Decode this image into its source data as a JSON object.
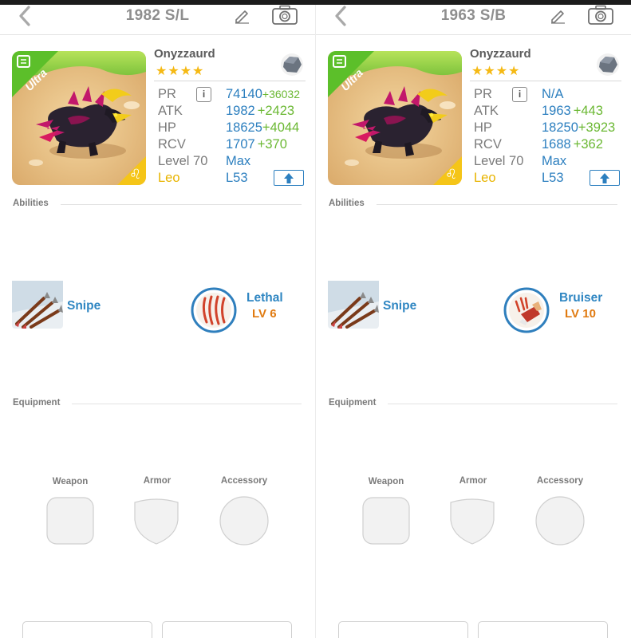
{
  "screens": [
    {
      "title": "1982 S/L",
      "monster": {
        "name": "Onyzzaurd",
        "stars": "★★★★",
        "rarity": "Ultra",
        "element": "stone",
        "zodiac_glyph": "♌"
      },
      "stats": {
        "pr_label": "PR",
        "pr_value": "74140",
        "pr_bonus": "+36032",
        "info_icon_text": "i",
        "atk_label": "ATK",
        "atk_value": "1982",
        "atk_bonus": "+2423",
        "hp_label": "HP",
        "hp_value": "18625",
        "hp_bonus": "+4044",
        "rcv_label": "RCV",
        "rcv_value": "1707",
        "rcv_bonus": "+370",
        "level_label": "Level 70",
        "level_value": "Max",
        "sign_label": "Leo",
        "sign_value": "L53"
      },
      "abilities_header": "Abilities",
      "abilities": [
        {
          "name": "Snipe",
          "level": ""
        },
        {
          "name": "Lethal",
          "level": "LV 6"
        }
      ],
      "equipment_header": "Equipment",
      "equipment": {
        "weapon": "Weapon",
        "armor": "Armor",
        "accessory": "Accessory"
      }
    },
    {
      "title": "1963 S/B",
      "monster": {
        "name": "Onyzzaurd",
        "stars": "★★★★",
        "rarity": "Ultra",
        "element": "stone",
        "zodiac_glyph": "♌"
      },
      "stats": {
        "pr_label": "PR",
        "pr_value": "N/A",
        "pr_bonus": "",
        "info_icon_text": "i",
        "atk_label": "ATK",
        "atk_value": "1963",
        "atk_bonus": "+443",
        "hp_label": "HP",
        "hp_value": "18250",
        "hp_bonus": "+3923",
        "rcv_label": "RCV",
        "rcv_value": "1688",
        "rcv_bonus": "+362",
        "level_label": "Level 70",
        "level_value": "Max",
        "sign_label": "Leo",
        "sign_value": "L53"
      },
      "abilities_header": "Abilities",
      "abilities": [
        {
          "name": "Snipe",
          "level": ""
        },
        {
          "name": "Bruiser",
          "level": "LV 10"
        }
      ],
      "equipment_header": "Equipment",
      "equipment": {
        "weapon": "Weapon",
        "armor": "Armor",
        "accessory": "Accessory"
      }
    }
  ],
  "colors": {
    "value_blue": "#2c7fbf",
    "bonus_green": "#6bb833",
    "level_orange": "#e07a10",
    "star_gold": "#f5b914",
    "ultra_green": "#5cbf2a"
  }
}
